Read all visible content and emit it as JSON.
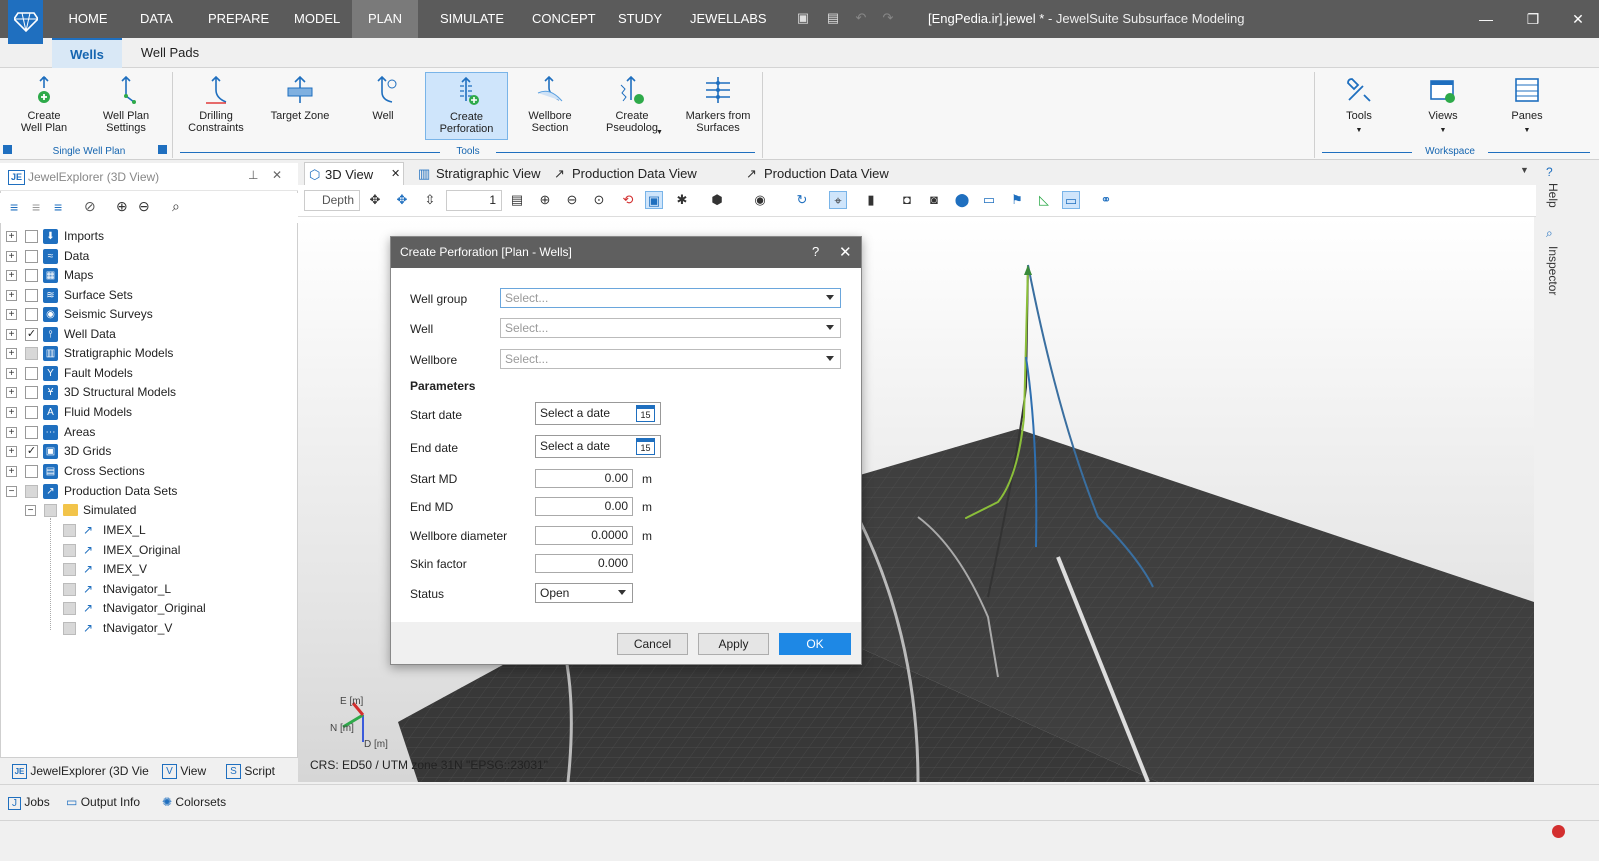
{
  "app": {
    "title_doc": "[EngPedia.ir].jewel *",
    "title_app": " - JewelSuite Subsurface Modeling"
  },
  "menu": [
    "HOME",
    "DATA",
    "PREPARE",
    "MODEL",
    "PLAN",
    "SIMULATE",
    "CONCEPT",
    "STUDY",
    "JEWELLABS"
  ],
  "menu_active": "PLAN",
  "subtabs": {
    "wells": "Wells",
    "well_pads": "Well Pads"
  },
  "ribbon": {
    "create_well_plan": "Create\nWell Plan",
    "well_plan_settings": "Well Plan\nSettings",
    "drilling_constraints": "Drilling\nConstraints",
    "target_zone": "Target Zone",
    "well": "Well",
    "create_perforation": "Create\nPerforation",
    "wellbore_section": "Wellbore\nSection",
    "create_pseudolog": "Create\nPseudolog",
    "markers_from_surfaces": "Markers from\nSurfaces",
    "tools": "Tools",
    "views": "Views",
    "panes": "Panes",
    "group_single_well_plan": "Single Well Plan",
    "group_tools": "Tools",
    "group_workspace": "Workspace"
  },
  "explorer": {
    "title": "JewelExplorer (3D View)",
    "items": [
      {
        "label": "Imports",
        "checked": false
      },
      {
        "label": "Data",
        "checked": false
      },
      {
        "label": "Maps",
        "checked": false
      },
      {
        "label": "Surface Sets",
        "checked": false
      },
      {
        "label": "Seismic Surveys",
        "checked": false
      },
      {
        "label": "Well Data",
        "checked": true
      },
      {
        "label": "Stratigraphic Models",
        "checked": false
      },
      {
        "label": "Fault Models",
        "checked": false
      },
      {
        "label": "3D Structural Models",
        "checked": false
      },
      {
        "label": "Fluid Models",
        "checked": false
      },
      {
        "label": "Areas",
        "checked": false
      },
      {
        "label": "3D Grids",
        "checked": true
      },
      {
        "label": "Cross Sections",
        "checked": false
      },
      {
        "label": "Production Data Sets",
        "checked": false
      }
    ],
    "simulated": "Simulated",
    "datasets": [
      "IMEX_L",
      "IMEX_Original",
      "IMEX_V",
      "tNavigator_L",
      "tNavigator_Original",
      "tNavigator_V"
    ],
    "footer": {
      "explorer": "JewelExplorer (3D Vie",
      "view": "View",
      "script": "Script"
    }
  },
  "viewtabs": [
    "3D View",
    "Stratigraphic View",
    "Production Data View (IMEX)",
    "Production Data View (tNavigator)"
  ],
  "viewtoolbar": {
    "depth": "Depth",
    "value": "1"
  },
  "crs": "CRS: ED50 / UTM zone 31N \"EPSG::23031\"",
  "axes": {
    "e": "E [m]",
    "n": "N [m]",
    "d": "D [m]"
  },
  "side": {
    "help": "Help",
    "inspector": "Inspector"
  },
  "bottom": {
    "jobs": "Jobs",
    "output": "Output Info",
    "colorsets": "Colorsets"
  },
  "dialog": {
    "title": "Create Perforation [Plan - Wells]",
    "help": "?",
    "well_group_label": "Well group",
    "well_label": "Well",
    "wellbore_label": "Wellbore",
    "select_placeholder": "Select...",
    "parameters": "Parameters",
    "start_date_label": "Start date",
    "end_date_label": "End date",
    "date_placeholder": "Select a date",
    "calendar_day": "15",
    "start_md_label": "Start MD",
    "start_md": "0.00",
    "end_md_label": "End MD",
    "end_md": "0.00",
    "wellbore_diameter_label": "Wellbore diameter",
    "wellbore_diameter": "0.0000",
    "skin_factor_label": "Skin factor",
    "skin_factor": "0.000",
    "status_label": "Status",
    "status": "Open",
    "unit_m": "m",
    "cancel": "Cancel",
    "apply": "Apply",
    "ok": "OK"
  },
  "colors": {
    "accent": "#1f6fbf",
    "menubar": "#5b5b5b",
    "ok": "#1e88e5"
  }
}
